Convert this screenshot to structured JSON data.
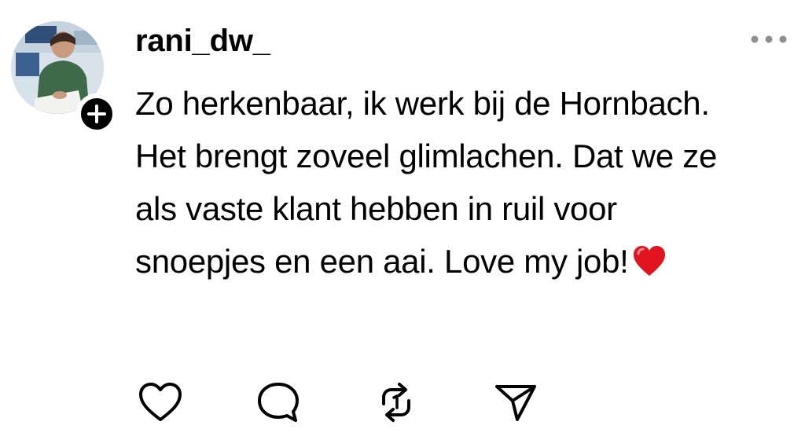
{
  "post": {
    "username": "rani_dw_",
    "text": "Zo herkenbaar, ik werk bij de Hornbach.\nHet brengt zoveel glimlachen. Dat we ze\nals vaste klant hebben in ruil voor\nsnoepjes en een aai. Love my job!",
    "emoji": "red-heart-emoji"
  },
  "icons": {
    "avatar": "profile-photo",
    "follow": "plus-icon",
    "more": "more-dots-icon",
    "like": "heart-outline-icon",
    "comment": "comment-bubble-icon",
    "repost": "repost-icon",
    "share": "send-icon"
  },
  "colors": {
    "text": "#000000",
    "icon": "#000000",
    "more_dots": "#8e8e93",
    "heart_emoji": "#e0141e",
    "background": "#ffffff"
  }
}
